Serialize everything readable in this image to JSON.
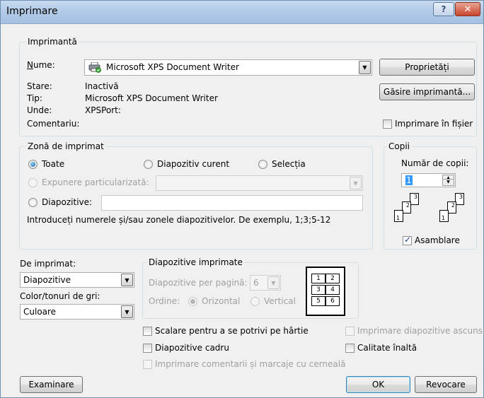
{
  "window": {
    "title": "Imprimare",
    "help": "?",
    "close": "✕"
  },
  "printer": {
    "group_title": "Imprimantă",
    "name_label": "Nume:",
    "name_value": "Microsoft XPS Document Writer",
    "status_label": "Stare:",
    "status_value": "Inactivă",
    "type_label": "Tip:",
    "type_value": "Microsoft XPS Document Writer",
    "where_label": "Unde:",
    "where_value": "XPSPort:",
    "comment_label": "Comentariu:",
    "properties_button": "Proprietăți",
    "find_button": "Găsire imprimantă...",
    "print_to_file": {
      "label": "Imprimare în fișier",
      "checked": false
    }
  },
  "print_range": {
    "group_title": "Zonă de imprimat",
    "all": {
      "label": "Toate",
      "selected": true
    },
    "current": {
      "label": "Diapozitiv curent",
      "selected": false
    },
    "selection": {
      "label": "Selecția",
      "selected": false
    },
    "custom_show": {
      "label": "Expunere particularizată:",
      "selected": false,
      "value": ""
    },
    "slides": {
      "label": "Diapozitive:",
      "selected": false,
      "value": ""
    },
    "hint": "Introduceți numerele și/sau zonele diapozitivelor. De exemplu, 1;3;5-12"
  },
  "copies": {
    "group_title": "Copii",
    "count_label": "Număr de copii:",
    "count_value": "1",
    "collate": {
      "label": "Asamblare",
      "checked": true
    },
    "collate_pages": [
      "1",
      "2",
      "3",
      "1",
      "2",
      "3"
    ]
  },
  "print_what": {
    "label": "De imprimat:",
    "value": "Diapozitive",
    "color_label": "Color/tonuri de gri:",
    "color_value": "Culoare"
  },
  "handouts": {
    "group_title": "Diapozitive imprimate",
    "per_page_label": "Diapozitive per pagină:",
    "per_page_value": "6",
    "order_label": "Ordine:",
    "horizontal": {
      "label": "Orizontal",
      "selected": true
    },
    "vertical": {
      "label": "Vertical",
      "selected": false
    },
    "preview_numbers": [
      "1",
      "2",
      "3",
      "4",
      "5",
      "6"
    ]
  },
  "options": {
    "scale": {
      "label": "Scalare pentru a se potrivi pe hârtie",
      "checked": false
    },
    "frame": {
      "label": "Diapozitive cadru",
      "checked": false
    },
    "comments": {
      "label": "Imprimare comentarii și marcaje cu cerneală",
      "checked": false
    },
    "hidden": {
      "label": "Imprimare diapozitive ascunse",
      "checked": false
    },
    "quality": {
      "label": "Calitate înaltă",
      "checked": false
    }
  },
  "footer": {
    "preview": "Examinare",
    "ok": "OK",
    "cancel": "Revocare"
  }
}
